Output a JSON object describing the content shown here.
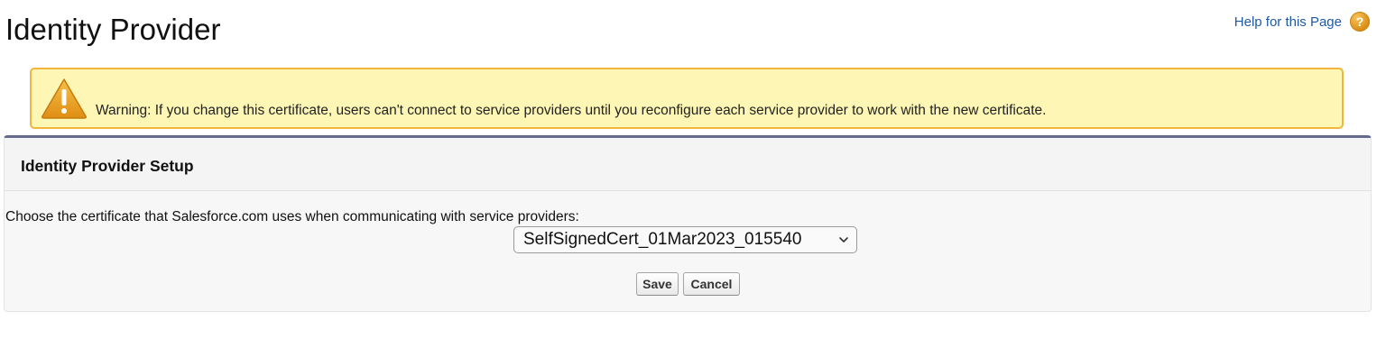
{
  "header": {
    "title": "Identity Provider",
    "help_link": "Help for this Page",
    "help_icon": "question-circle-icon"
  },
  "warning": {
    "icon": "warning-triangle-icon",
    "text": "Warning: If you change this certificate, users can't connect to service providers until you reconfigure each service provider to work with the new certificate.",
    "background": "#fdf6b4",
    "border": "#f1b63b"
  },
  "setup": {
    "title": "Identity Provider Setup",
    "choose_label": "Choose the certificate that Salesforce.com uses when communicating with service providers:",
    "certificate_select": {
      "selected": "SelfSignedCert_01Mar2023_015540",
      "icon": "chevron-down-icon"
    },
    "save_label": "Save",
    "cancel_label": "Cancel",
    "accent": "#646b8c"
  }
}
